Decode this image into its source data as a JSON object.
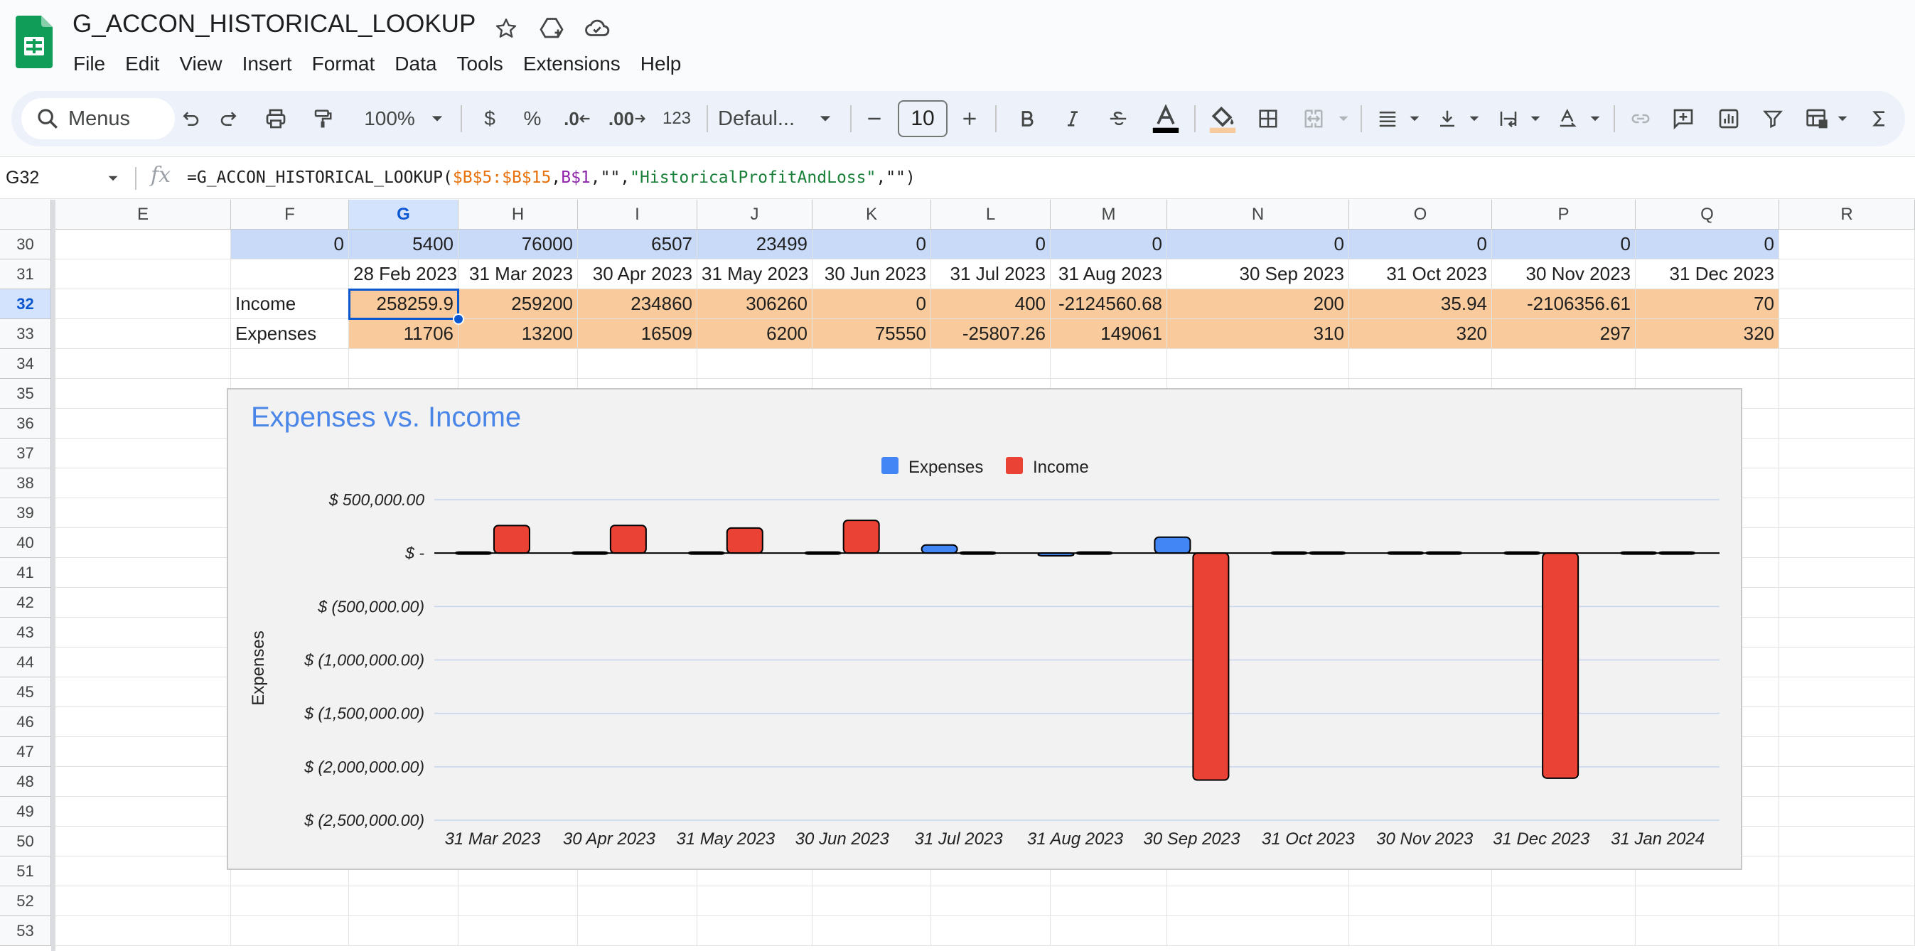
{
  "app": {
    "title": "G_ACCON_HISTORICAL_LOOKUP"
  },
  "menu": [
    "File",
    "Edit",
    "View",
    "Insert",
    "Format",
    "Data",
    "Tools",
    "Extensions",
    "Help"
  ],
  "toolbar": {
    "search_label": "Menus",
    "zoom": "100%",
    "currency": "$",
    "percent": "%",
    "dec_minus": ".0",
    "dec_plus": ".00",
    "format_123": "123",
    "font": "Defaul...",
    "font_size": "10"
  },
  "formula_bar": {
    "cell_ref": "G32",
    "fx": "fx",
    "formula_prefix": "=G_ACCON_HISTORICAL_LOOKUP(",
    "arg1": "$B$5:$B$15",
    "comma1": ",",
    "arg2": "B$1",
    "rest_a": ",\"\",",
    "arg3": "\"HistoricalProfitAndLoss\"",
    "rest_b": ",\"\")"
  },
  "sheet": {
    "columns": [
      "E",
      "F",
      "G",
      "H",
      "I",
      "J",
      "K",
      "L",
      "M",
      "N",
      "O",
      "P",
      "Q",
      "R"
    ],
    "selected_column": "G",
    "rows": [
      "30",
      "31",
      "32",
      "33",
      "34",
      "35",
      "36",
      "37",
      "38",
      "39",
      "40",
      "41",
      "42",
      "43",
      "44",
      "45",
      "46",
      "47",
      "48",
      "49",
      "50",
      "51",
      "52",
      "53"
    ],
    "selected_row": "32",
    "row30": {
      "F": "0",
      "G": "5400",
      "H": "76000",
      "I": "6507",
      "J": "23499",
      "K": "0",
      "L": "0",
      "M": "0",
      "N": "0",
      "O": "0",
      "P": "0",
      "Q": "0"
    },
    "row31": {
      "G": "28 Feb 2023",
      "H": "31 Mar 2023",
      "I": "30 Apr 2023",
      "J": "31 May 2023",
      "K": "30 Jun 2023",
      "L": "31 Jul 2023",
      "M": "31 Aug 2023",
      "N": "30 Sep 2023",
      "O": "31 Oct 2023",
      "P": "30 Nov 2023",
      "Q": "31 Dec 2023"
    },
    "row32": {
      "F": "Income",
      "G": "258259.9",
      "H": "259200",
      "I": "234860",
      "J": "306260",
      "K": "0",
      "L": "400",
      "M": "-2124560.68",
      "N": "200",
      "O": "35.94",
      "P": "-2106356.61",
      "Q": "70"
    },
    "row33": {
      "F": "Expenses",
      "G": "11706",
      "H": "13200",
      "I": "16509",
      "J": "6200",
      "K": "75550",
      "L": "-25807.26",
      "M": "149061",
      "N": "310",
      "O": "320",
      "P": "297",
      "Q": "320"
    }
  },
  "colors": {
    "expenses": "#4285f4",
    "income": "#ea4335",
    "title": "#4a86e8",
    "header_blue": "#c9daf8",
    "cell_orange": "#f9cb9c"
  },
  "chart_data": {
    "type": "bar",
    "title": "Expenses vs. Income",
    "xlabel": "",
    "ylabel": "Expenses",
    "legend": "top-center",
    "grid": true,
    "ylim": [
      -2500000,
      500000
    ],
    "yticks": [
      500000,
      0,
      -500000,
      -1000000,
      -1500000,
      -2000000,
      -2500000
    ],
    "ytick_labels": [
      "$ 500,000.00",
      "$ -",
      "$ (500,000.00)",
      "$ (1,000,000.00)",
      "$ (1,500,000.00)",
      "$ (2,000,000.00)",
      "$ (2,500,000.00)"
    ],
    "categories": [
      "31 Mar 2023",
      "30 Apr 2023",
      "31 May 2023",
      "30 Jun 2023",
      "31 Jul 2023",
      "31 Aug 2023",
      "30 Sep 2023",
      "31 Oct 2023",
      "30 Nov 2023",
      "31 Dec 2023",
      "31 Jan 2024"
    ],
    "series": [
      {
        "name": "Expenses",
        "color": "#4285f4",
        "values": [
          11706,
          13200,
          16509,
          6200,
          75550,
          -25807.26,
          149061,
          310,
          320,
          297,
          320
        ]
      },
      {
        "name": "Income",
        "color": "#ea4335",
        "values": [
          258259.9,
          259200,
          234860,
          306260,
          0,
          400,
          -2124560.68,
          200,
          35.94,
          -2106356.61,
          70
        ]
      }
    ]
  }
}
